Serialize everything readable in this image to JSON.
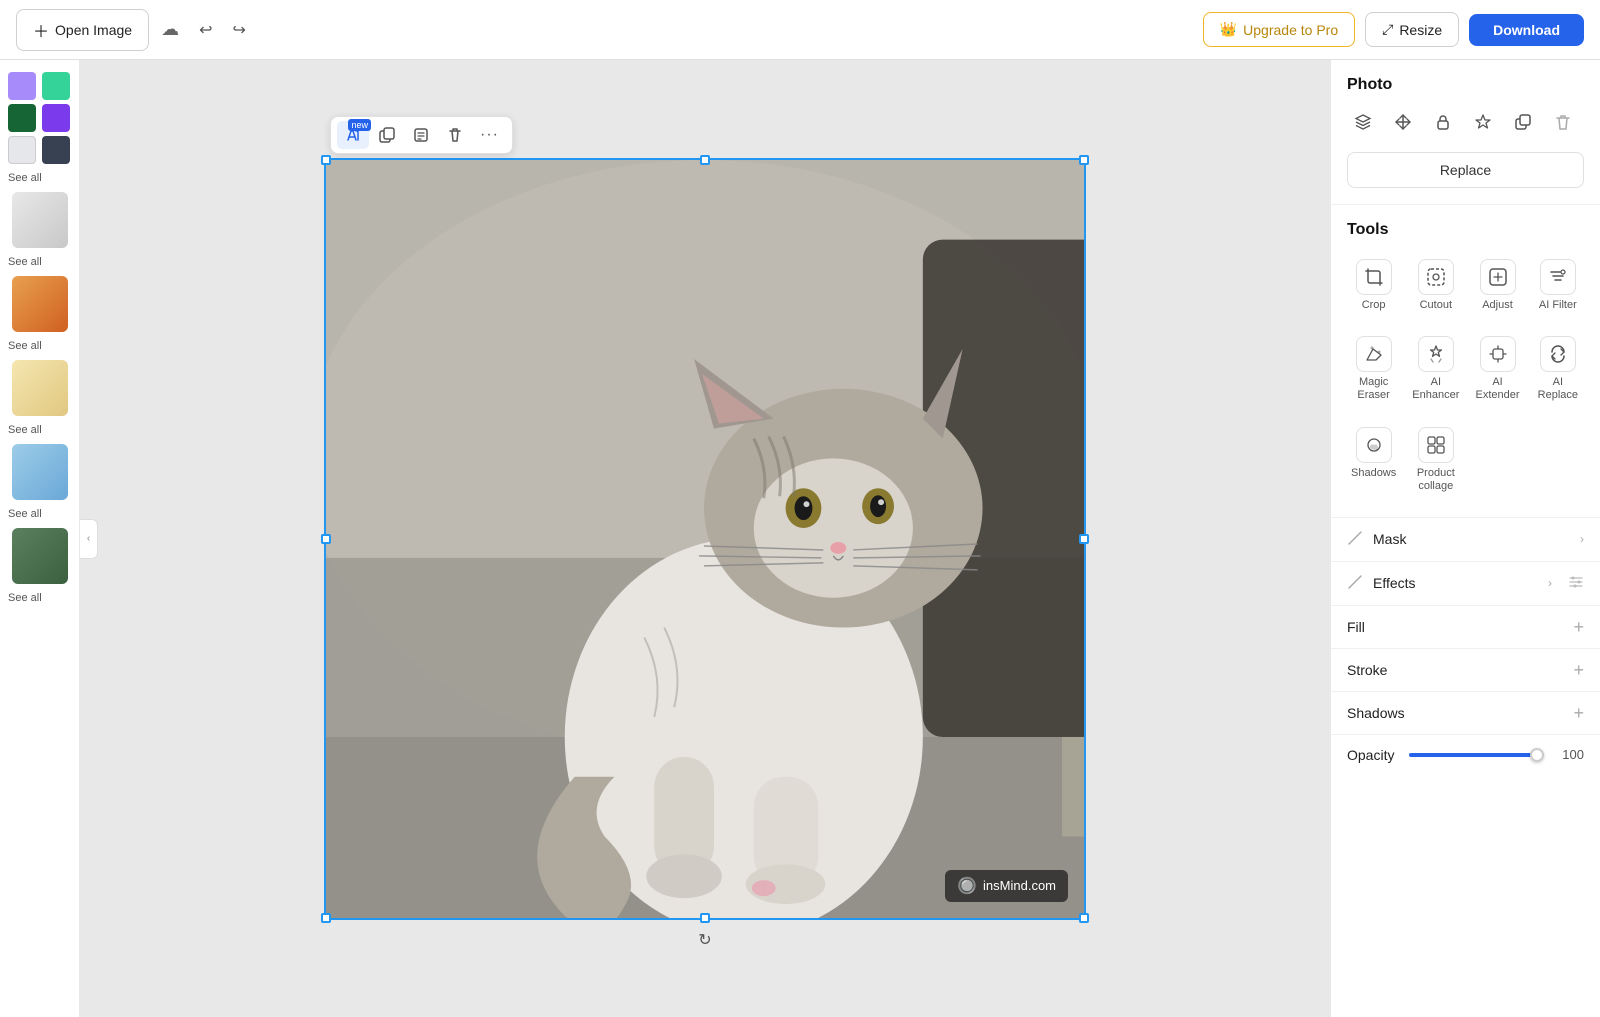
{
  "topbar": {
    "open_image_label": "Open Image",
    "upgrade_label": "Upgrade to Pro",
    "resize_label": "Resize",
    "download_label": "Download"
  },
  "left_sidebar": {
    "see_all_label": "See all",
    "colors": [
      {
        "color": "#a78bfa",
        "name": "purple-light"
      },
      {
        "color": "#34d399",
        "name": "green-teal"
      },
      {
        "color": "#166534",
        "name": "green-dark"
      },
      {
        "color": "#7c3aed",
        "name": "purple-dark"
      },
      {
        "color": "#e5e7eb",
        "name": "gray-light"
      },
      {
        "color": "#374151",
        "name": "gray-dark"
      }
    ]
  },
  "canvas": {
    "watermark_text": "insMind.com"
  },
  "floating_toolbar": {
    "btn_ai_label": "AI",
    "btn_new_badge": "new",
    "btn_duplicate_label": "duplicate",
    "btn_copy_label": "copy",
    "btn_delete_label": "delete",
    "btn_more_label": "more"
  },
  "right_panel": {
    "photo_title": "Photo",
    "replace_label": "Replace",
    "tools_title": "Tools",
    "tools": [
      {
        "label": "Crop",
        "icon": "crop"
      },
      {
        "label": "Cutout",
        "icon": "cutout"
      },
      {
        "label": "Adjust",
        "icon": "adjust"
      },
      {
        "label": "AI Filter",
        "icon": "ai-filter"
      },
      {
        "label": "Magic Eraser",
        "icon": "magic-eraser"
      },
      {
        "label": "AI Enhancer",
        "icon": "ai-enhancer"
      },
      {
        "label": "AI Extender",
        "icon": "ai-extender"
      },
      {
        "label": "AI Replace",
        "icon": "ai-replace"
      },
      {
        "label": "Shadows",
        "icon": "shadows"
      },
      {
        "label": "Product collage",
        "icon": "product-collage"
      }
    ],
    "mask_label": "Mask",
    "effects_label": "Effects",
    "fill_label": "Fill",
    "stroke_label": "Stroke",
    "shadows_label": "Shadows",
    "opacity_label": "Opacity",
    "opacity_value": "100"
  }
}
